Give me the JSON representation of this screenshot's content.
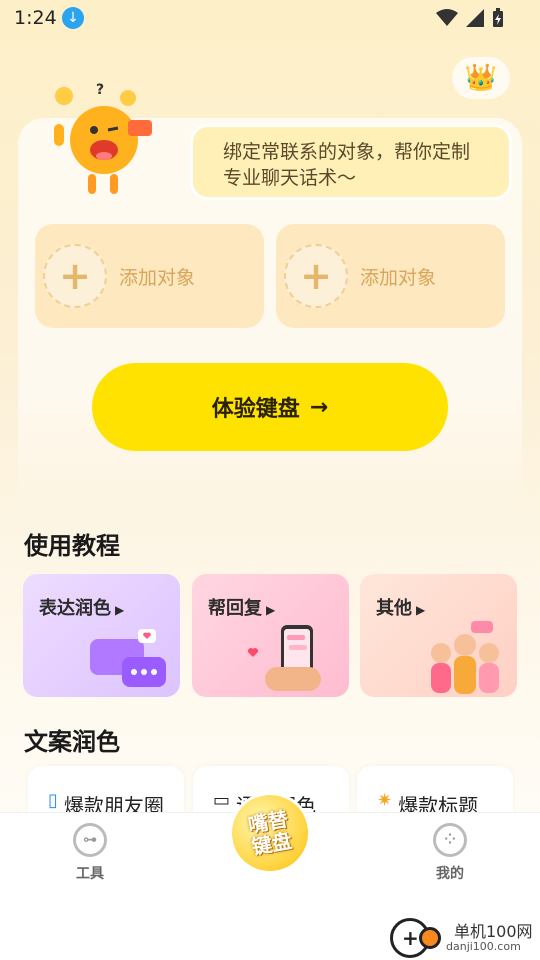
{
  "status": {
    "time": "1:24"
  },
  "header": {
    "crown_icon": "crown-icon"
  },
  "bubble": {
    "line1": "绑定常联系的对象，帮你定制",
    "line2": "专业聊天话术～"
  },
  "add_slots": [
    {
      "label": "添加对象"
    },
    {
      "label": "添加对象"
    }
  ],
  "cta": {
    "label": "体验键盘",
    "arrow": "→"
  },
  "tutorial": {
    "title": "使用教程",
    "cards": [
      {
        "label": "表达润色",
        "color": "#e7d2ff"
      },
      {
        "label": "帮回复",
        "color": "#ffc9d8"
      },
      {
        "label": "其他",
        "color": "#ffd9cf"
      }
    ]
  },
  "copywriting": {
    "title": "文案润色",
    "chips": [
      {
        "label": "爆款朋友圈",
        "icon": "phone-icon"
      },
      {
        "label": "语态润色",
        "icon": "chat-bubble-icon"
      },
      {
        "label": "爆款标题",
        "icon": "star-icon"
      }
    ]
  },
  "tabbar": {
    "tools": "工具",
    "center": "嘴替键盘",
    "mine": "我的"
  },
  "watermark": {
    "name": "单机100网",
    "url": "danji100.com"
  }
}
